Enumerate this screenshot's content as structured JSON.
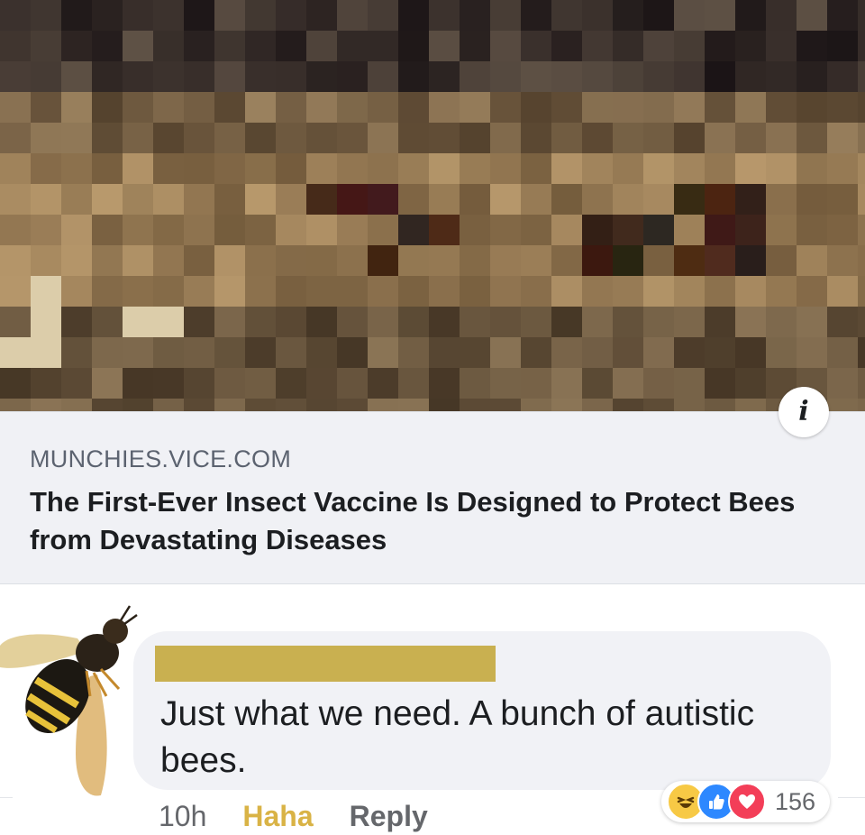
{
  "link_preview": {
    "domain": "MUNCHIES.VICE.COM",
    "title": "The First-Ever Insect Vaccine Is Designed to Protect Bees from Devastating Diseases",
    "info_icon": "info-icon"
  },
  "comment": {
    "avatar": "bee-avatar",
    "text": "Just what we need. A bunch of autistic bees.",
    "time": "10h",
    "reaction_link": "Haha",
    "reply_link": "Reply",
    "reactions": {
      "icons": [
        "haha-icon",
        "like-icon",
        "love-icon"
      ],
      "count": "156"
    }
  },
  "colors": {
    "redaction": "#c9b050",
    "haha_link": "#d9b346",
    "like": "#2d88ff",
    "love": "#f33e58",
    "haha": "#f7c945"
  }
}
